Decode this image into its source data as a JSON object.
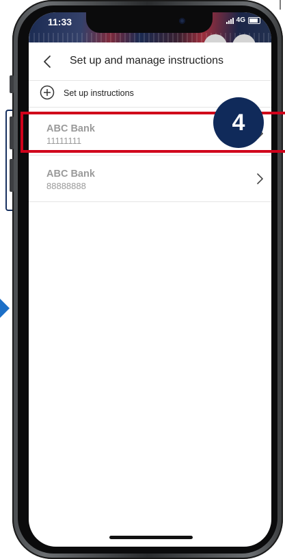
{
  "status_bar": {
    "time": "11:33",
    "network": "4G"
  },
  "header": {
    "title": "Set up and manage instructions"
  },
  "actions": {
    "setup_label": "Set up instructions"
  },
  "accounts": [
    {
      "name": "ABC Bank",
      "number": "11111111"
    },
    {
      "name": "ABC Bank",
      "number": "88888888"
    }
  ],
  "tutorial": {
    "step_number": "4",
    "highlight_color": "#d0021b",
    "badge_color": "#102a5a",
    "arrow_color": "#1c6fc7"
  },
  "icons": {
    "back": "chevron-left-icon",
    "add": "plus-circle-icon",
    "row_arrow": "chevron-right-icon"
  }
}
